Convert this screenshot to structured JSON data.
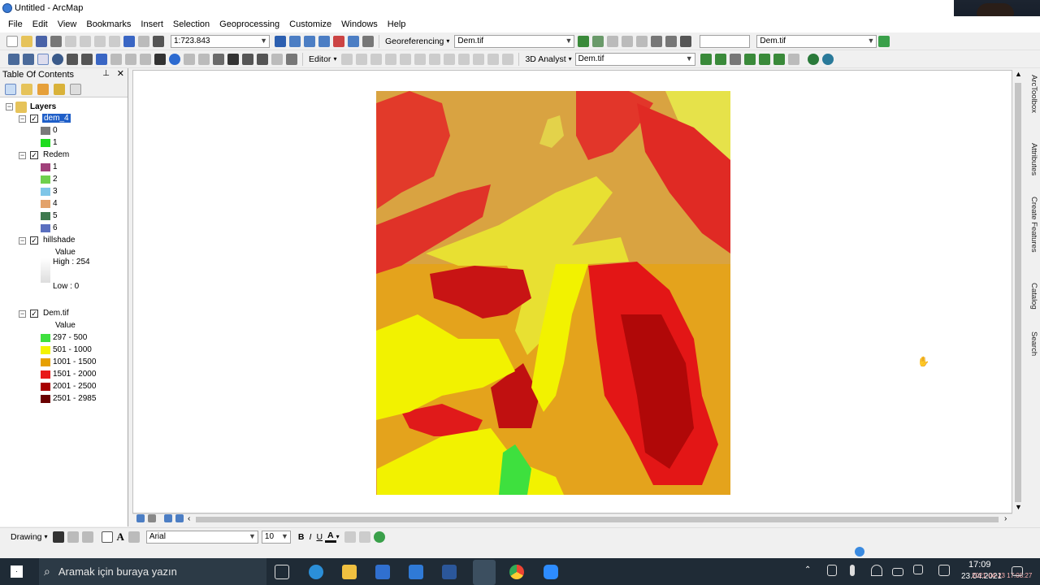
{
  "window": {
    "title": "Untitled - ArcMap"
  },
  "menu": [
    "File",
    "Edit",
    "View",
    "Bookmarks",
    "Insert",
    "Selection",
    "Geoprocessing",
    "Customize",
    "Windows",
    "Help"
  ],
  "toolbar1": {
    "scale": "1:723.843",
    "georef_label": "Georeferencing",
    "georef_layer": "Dem.tif",
    "layer_select": "Dem.tif"
  },
  "toolbar2": {
    "editor_label": "Editor",
    "analyst_label": "3D Analyst",
    "analyst_layer": "Dem.tif"
  },
  "toc": {
    "title": "Table Of Contents",
    "root": "Layers",
    "layers": [
      {
        "name": "dem_4",
        "selected": true,
        "items": [
          {
            "label": "0",
            "color": "#7a7a7a"
          },
          {
            "label": "1",
            "color": "#1fdc1f"
          }
        ]
      },
      {
        "name": "Redem",
        "items": [
          {
            "label": "1",
            "color": "#a0407a"
          },
          {
            "label": "2",
            "color": "#6fd04c"
          },
          {
            "label": "3",
            "color": "#7fc6e8"
          },
          {
            "label": "4",
            "color": "#e3a26a"
          },
          {
            "label": "5",
            "color": "#3f7a4f"
          },
          {
            "label": "6",
            "color": "#5a6fbf"
          }
        ]
      },
      {
        "name": "hillshade",
        "value_label": "Value",
        "high": "High : 254",
        "low": "Low : 0"
      },
      {
        "name": "Dem.tif",
        "value_label": "Value",
        "items": [
          {
            "label": "297 - 500",
            "color": "#3ee03e"
          },
          {
            "label": "501 - 1000",
            "color": "#f3f300"
          },
          {
            "label": "1001 - 1500",
            "color": "#e6a000"
          },
          {
            "label": "1501 - 2000",
            "color": "#e81818"
          },
          {
            "label": "2001 - 2500",
            "color": "#a80000"
          },
          {
            "label": "2501 - 2985",
            "color": "#6a0000"
          }
        ]
      }
    ]
  },
  "right_tabs": [
    "ArcToolbox",
    "Attributes",
    "Create Features",
    "Catalog",
    "Search"
  ],
  "drawing": {
    "label": "Drawing",
    "font": "Arial",
    "size": "10",
    "bold": "B",
    "italic": "I",
    "underline": "U",
    "font_color": "A"
  },
  "taskbar": {
    "search_placeholder": "Aramak için buraya yazın",
    "time": "17:09",
    "date": "23.04.2021"
  },
  "watermark": "2021-04-23 17:08:27"
}
